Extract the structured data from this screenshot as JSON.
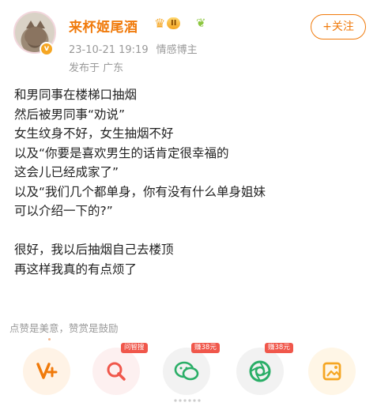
{
  "post": {
    "username": "来杯姬尾酒",
    "level": "II",
    "timestamp": "23-10-21 19:19",
    "user_tag": "情感博主",
    "location": "发布于 广东",
    "follow_label": "+关注",
    "lines": [
      "和男同事在楼梯口抽烟",
      "然后被男同事“劝说”",
      "女生纹身不好，女生抽烟不好",
      "以及“你要是喜欢男生的话肯定很幸福的",
      "这会儿已经成家了”",
      "以及“我们几个都单身，你有没有什么单身姐妹",
      "可以介绍一下的?”",
      "",
      "很好，我以后抽烟自己去楼顶",
      "再这样我真的有点烦了"
    ]
  },
  "reward": {
    "hint": "点赞是美意，赞赏是鼓励"
  },
  "actions": [
    {
      "icon": "v-plus-icon",
      "tag": ""
    },
    {
      "icon": "search-q-icon",
      "tag": "问智搜"
    },
    {
      "icon": "wechat-icon",
      "tag": "赚38元"
    },
    {
      "icon": "camera-lens-icon",
      "tag": "赚38元"
    },
    {
      "icon": "image-share-icon",
      "tag": ""
    }
  ],
  "colors": {
    "accent": "#f07a0b",
    "muted": "#999999",
    "tag_red": "#f0574b",
    "wechat_green": "#2aae67"
  }
}
